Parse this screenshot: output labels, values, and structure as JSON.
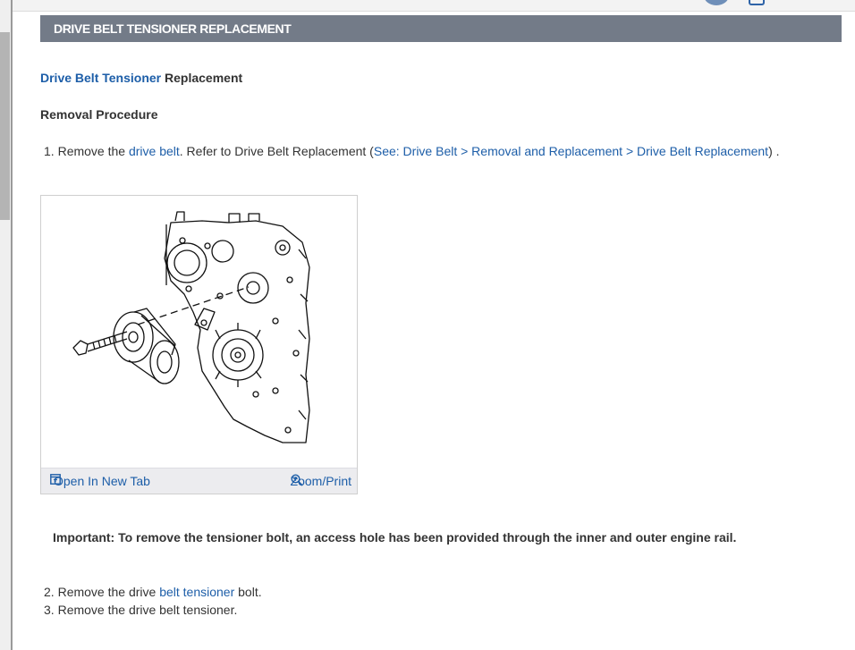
{
  "header": {
    "title": "DRIVE BELT TENSIONER REPLACEMENT"
  },
  "page_title": {
    "link": "Drive Belt Tensioner",
    "rest": " Replacement"
  },
  "removal": {
    "heading": "Removal Procedure",
    "step1": {
      "number": "1.",
      "pre": " Remove the ",
      "link1": "drive belt",
      "mid": ". Refer to Drive Belt Replacement (",
      "link2": "See: Drive Belt > Removal and Replacement > Drive Belt Replacement",
      "post": ") ."
    },
    "figure": {
      "open_tab_label": "Open In New Tab",
      "zoom_label": "Zoom/Print",
      "open_tab_icon": "open-in-new-tab-icon",
      "zoom_icon": "zoom-in-icon"
    },
    "important": "Important: To remove the tensioner bolt, an access hole has been provided through the inner and outer engine rail.",
    "step2": {
      "number": "2.",
      "pre": " Remove the drive ",
      "link": "belt tensioner",
      "post": " bolt."
    },
    "step3": {
      "number": "3.",
      "text": " Remove the drive belt tensioner."
    }
  },
  "colors": {
    "header_bg": "#737b88",
    "link": "#1d5ea8"
  }
}
